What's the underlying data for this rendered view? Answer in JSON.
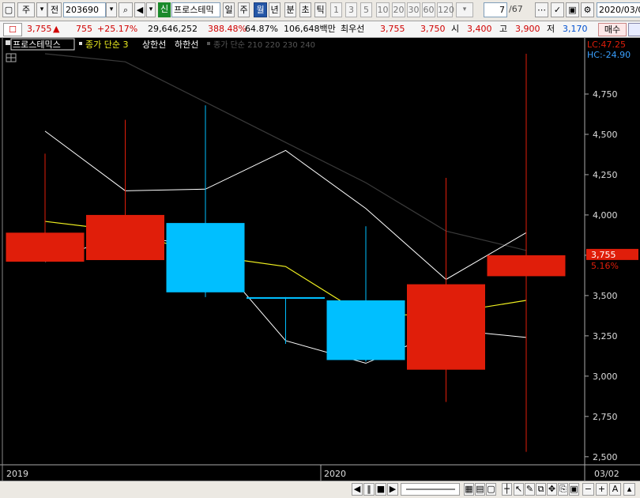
{
  "toolbar": {
    "market": "주",
    "prev_label": "전",
    "code": "203690",
    "badge": "신",
    "stock_name": "프로스테믹",
    "periods": [
      "일",
      "주",
      "월",
      "년",
      "분",
      "초",
      "틱"
    ],
    "selected_period": "월",
    "intervals": [
      "1",
      "3",
      "5",
      "10",
      "20",
      "30",
      "60",
      "120"
    ],
    "page": "7",
    "page_total": "/67",
    "date": "2020/03/0"
  },
  "quote": {
    "price": "3,755",
    "change": "755",
    "change_pct": "+25.17%",
    "volume": "29,646,252",
    "volume_ratio": "388.48%",
    "turnover": "64.87%",
    "amount": "106,648백만",
    "best_label": "최우선",
    "ask": "3,755",
    "bid": "3,750",
    "open_label": "시",
    "open": "3,400",
    "high_label": "고",
    "high": "3,900",
    "low_label": "저",
    "low": "3,170",
    "buy_label": "매수"
  },
  "legend": {
    "name": "프로스테믹스",
    "ma": "종가 단순 3",
    "upper": "상한선",
    "lower": "하한선",
    "faded": "종가 단순 210 220 230 240"
  },
  "chart_data": {
    "type": "candlestick",
    "ylim": [
      2450,
      5000
    ],
    "yticks": [
      2500,
      2750,
      3000,
      3250,
      3500,
      3750,
      4000,
      4250,
      4500,
      4750
    ],
    "ytick_labels": [
      "2,500",
      "2,750",
      "3,000",
      "3,250",
      "3,500",
      "3,750",
      "4,000",
      "4,250",
      "4,500",
      "4,750"
    ],
    "x_labels": [
      "2019",
      "2020",
      "03/02"
    ],
    "candles": [
      {
        "o": 3710,
        "h": 4380,
        "l": 3710,
        "c": 3890
      },
      {
        "o": 3720,
        "h": 4590,
        "l": 3720,
        "c": 4000
      },
      {
        "o": 3950,
        "h": 4680,
        "l": 3490,
        "c": 3520
      },
      {
        "o": 3490,
        "h": 3490,
        "l": 3200,
        "c": 3480
      },
      {
        "o": 3470,
        "h": 3930,
        "l": 3090,
        "c": 3100
      },
      {
        "o": 3040,
        "h": 4230,
        "l": 2840,
        "c": 3570
      },
      {
        "o": 3620,
        "h": 5000,
        "l": 2530,
        "c": 3750
      }
    ],
    "ma3": [
      3960,
      3900,
      3750,
      3680,
      3370,
      3390,
      3470
    ],
    "upper_band": [
      4520,
      4150,
      4160,
      4400,
      4040,
      3600,
      3890
    ],
    "lower_band": [
      3710,
      3880,
      3800,
      3220,
      3080,
      3290,
      3240
    ],
    "long_ma": [
      5000,
      4950,
      4700,
      4450,
      4200,
      3900,
      3780
    ],
    "last_price_label": "3,755",
    "last_pct_label": "5.16%",
    "lc_label": "LC:47.25",
    "hc_label": "HC:-24.90",
    "colors": {
      "up": "#e01e0a",
      "down": "#00bfff",
      "ma": "#f0f020",
      "band": "#ffffff",
      "long": "#3a3a3a"
    }
  }
}
